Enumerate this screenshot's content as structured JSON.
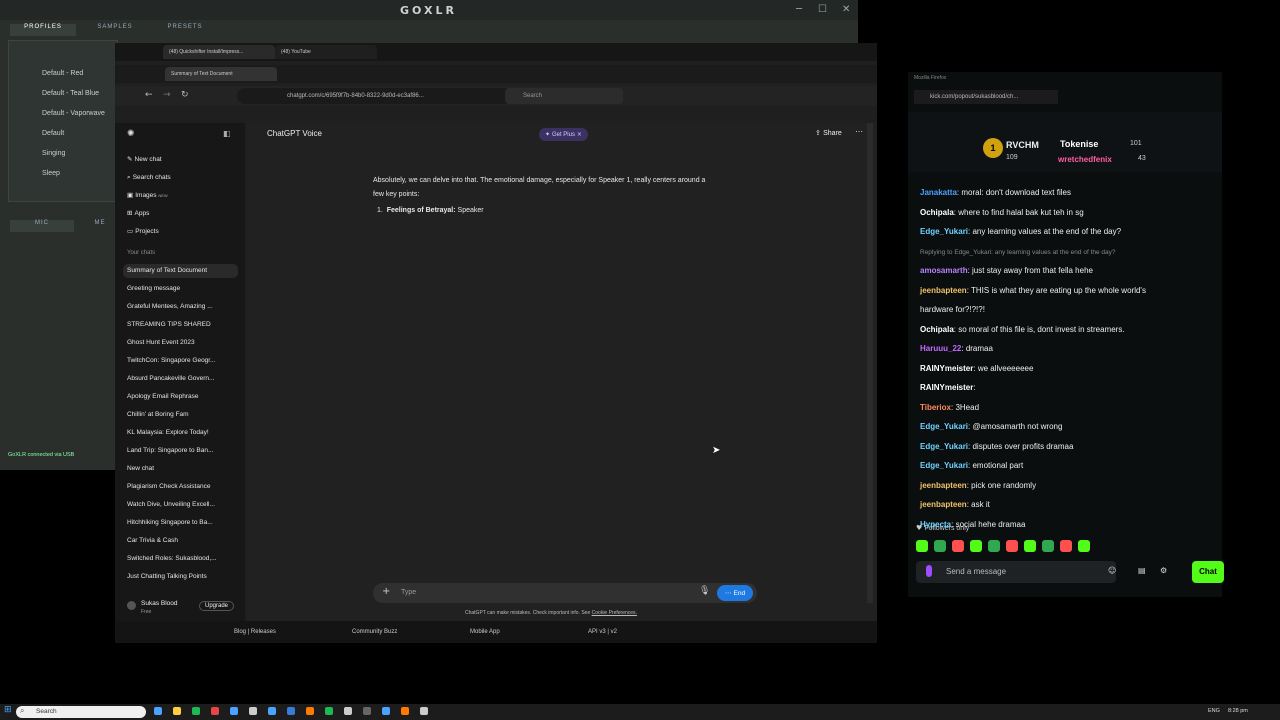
{
  "goxlr": {
    "title": "GOXLR",
    "tabs": [
      "PROFILES",
      "SAMPLES",
      "PRESETS"
    ],
    "profiles": [
      "Default - Red",
      "Default - Teal Blue",
      "Default - Vaporwave",
      "Default",
      "Singing",
      "Sleep"
    ],
    "bottom_tabs": [
      "MIC",
      "ME"
    ],
    "status": "GoXLR connected via USB"
  },
  "browser": {
    "top_tabs": [
      "(48) Quickshifter Install/Impress...",
      "(48) YouTube"
    ],
    "active_tab": "Summary of Text Document",
    "url": "chatgpt.com/c/695f9f7b-84b0-8322-9d0d-ec3af86...",
    "search_placeholder": "Search"
  },
  "chatgpt": {
    "header_title": "ChatGPT Voice",
    "get_plus": "Get Plus",
    "share": "Share",
    "nav": [
      "New chat",
      "Search chats",
      "Images",
      "Apps",
      "Projects"
    ],
    "images_badge": "NEW",
    "your_chats_label": "Your chats",
    "chats": [
      "Summary of Text Document",
      "Greeting message",
      "Grateful Mentees, Amazing ...",
      "STREAMING TIPS SHARED",
      "Ghost Hunt Event 2023",
      "TwitchCon: Singapore Geogr...",
      "Absurd Pancakeville Govern...",
      "Apology Email Rephrase",
      "Chillin' at Boring Fam",
      "KL Malaysia: Explore Today!",
      "Land Trip: Singapore to Ban...",
      "New chat",
      "Plagiarism Check Assistance",
      "Watch Dive, Unveiling Excell...",
      "Hitchhiking Singapore to Ba...",
      "Car Trivia & Cash",
      "Switched Roles: Sukasblood,...",
      "Just Chatting Talking Points"
    ],
    "user_name": "Sukas Blood",
    "user_plan": "Free",
    "upgrade": "Upgrade",
    "message_line1": "Absolutely, we can delve into that. The emotional damage, especially for Speaker 1, really centers around a",
    "message_line2": "few key points:",
    "list_number": "1.",
    "list_bold": "Feelings of Betrayal:",
    "list_text": "Speaker",
    "composer_placeholder": "Type",
    "end_button": "End",
    "disclaimer": "ChatGPT can make mistakes. Check important info. See",
    "disclaimer_link": "Cookie Preferences.",
    "footer_links": [
      "Blog | Releases",
      "Community Buzz",
      "Mobile App",
      "API v3 | v2"
    ]
  },
  "kick": {
    "window_title": "Mozilla Firefox",
    "url": "kick.com/popout/sukasblood/ch...",
    "leaders": [
      {
        "name": "RVCHM",
        "count": "109"
      },
      {
        "name": "Tokenise",
        "count": "101"
      },
      {
        "name": "wretchedfenix",
        "count": "43"
      }
    ],
    "messages": [
      {
        "user": "Janakatta",
        "text": "moral: don't download text files",
        "color": "#4aa3ff"
      },
      {
        "user": "Ochipala",
        "text": "where to find halal bak kut teh in sg",
        "color": "#ffffff"
      },
      {
        "user": "Edge_Yukari",
        "text": "any learning values at the end of the day?",
        "color": "#6fd3ff"
      },
      {
        "user": "",
        "text": "Replying to Edge_Yukari: any learning values at the end of the day?",
        "color": "#888888"
      },
      {
        "user": "amosamarth",
        "text": "just stay away from that fella hehe",
        "color": "#b983ff"
      },
      {
        "user": "jeenbapteen",
        "text": "THIS is what they are eating up the whole world's",
        "color": "#f0c26a"
      },
      {
        "user": "",
        "text": "hardware for?!?!?!",
        "color": "#eeeeee"
      },
      {
        "user": "Ochipala",
        "text": "so moral of this file is, dont invest in streamers.",
        "color": "#ffffff"
      },
      {
        "user": "Haruuu_22",
        "text": "dramaa",
        "color": "#c46bff"
      },
      {
        "user": "RAINYmeister",
        "text": "we allveeeeeee",
        "color": "#ffffff"
      },
      {
        "user": "RAINYmeister",
        "text": "",
        "color": "#ffffff"
      },
      {
        "user": "Tiberiox",
        "text": "3Head",
        "color": "#ff8a5c"
      },
      {
        "user": "Edge_Yukari",
        "text": "@amosamarth not wrong",
        "color": "#6fd3ff"
      },
      {
        "user": "Edge_Yukari",
        "text": "disputes over profits dramaa",
        "color": "#6fd3ff"
      },
      {
        "user": "Edge_Yukari",
        "text": "emotional part",
        "color": "#6fd3ff"
      },
      {
        "user": "jeenbapteen",
        "text": "pick one randomly",
        "color": "#f0c26a"
      },
      {
        "user": "jeenbapteen",
        "text": "ask it",
        "color": "#f0c26a"
      },
      {
        "user": "Hypecta",
        "text": "social hehe dramaa",
        "color": "#6fd3ff"
      }
    ],
    "followers_only": "Followers only",
    "input_placeholder": "Send a message",
    "chat_button": "Chat"
  },
  "taskbar": {
    "search": "Search",
    "lang": "ENG",
    "time": "8:28 pm"
  },
  "colors": {
    "kick_green": "#53fc18",
    "chatgpt_blue": "#1e7ae0"
  }
}
